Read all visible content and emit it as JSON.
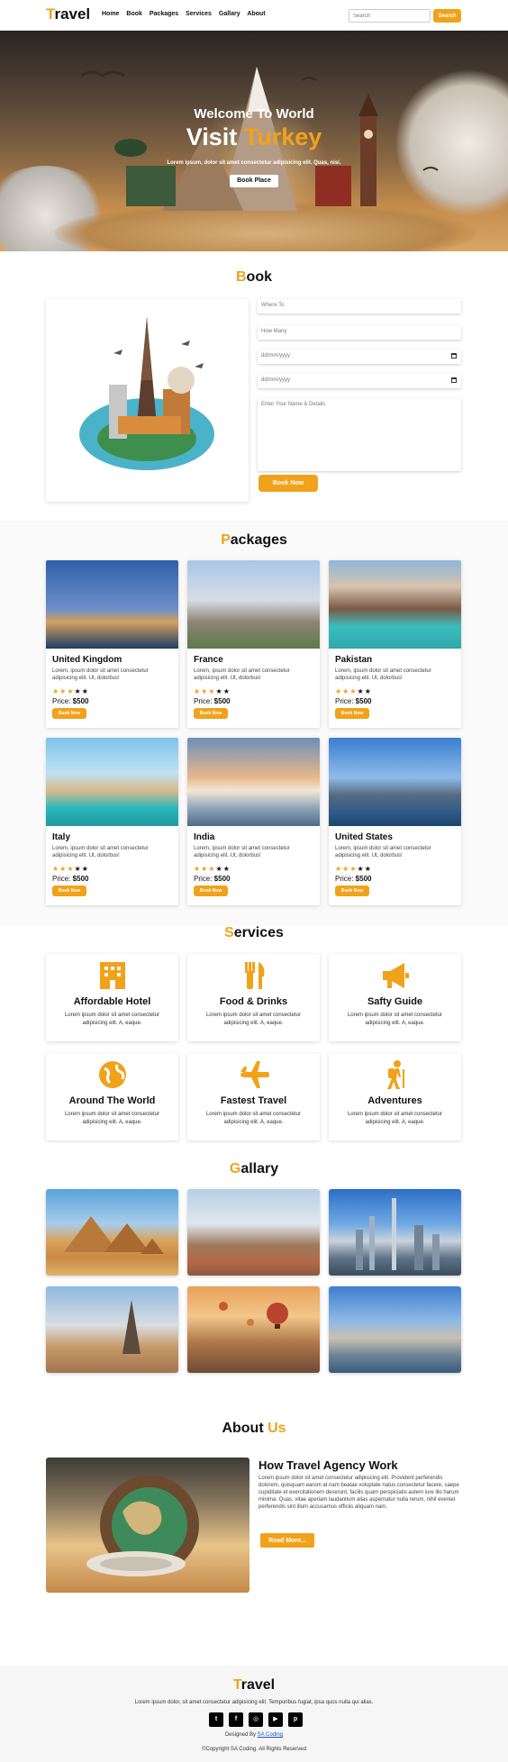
{
  "nav": {
    "logo_first": "T",
    "logo_rest": "ravel",
    "links": [
      "Home",
      "Book",
      "Packages",
      "Services",
      "Gallary",
      "About"
    ],
    "search_placeholder": "Search",
    "search_button": "Search"
  },
  "hero": {
    "subtitle": "Welcome To World",
    "title_white": "Visit ",
    "title_orange": "Turkey",
    "description": "Lorem ipsum, dolor sit amet consectetur adipisicing elit. Quas, nisi.",
    "button": "Book Place"
  },
  "book": {
    "title_first": "B",
    "title_rest": "ook",
    "fields": [
      "Where To",
      "How Many",
      "dd/mm/yyyy",
      "dd/mm/yyyy"
    ],
    "textarea_placeholder": "Enter Your Name & Details",
    "button": "Book Now"
  },
  "packages": {
    "title_first": "P",
    "title_rest": "ackages",
    "description": "Lorem, ipsum dolor sit amet consectetur adipisicing elit. Ut, dolorbus!",
    "price_label": "Price: ",
    "price": "$500",
    "button": "Book Now",
    "items": [
      {
        "name": "United Kingdom",
        "rating": 3
      },
      {
        "name": "France",
        "rating": 3
      },
      {
        "name": "Pakistan",
        "rating": 3
      },
      {
        "name": "Italy",
        "rating": 3
      },
      {
        "name": "India",
        "rating": 3
      },
      {
        "name": "United States",
        "rating": 3
      }
    ]
  },
  "services": {
    "title_first": "S",
    "title_rest": "ervices",
    "description": "Lorem ipsum dolor sit amet consectetur adipisicing elit. A, eaque.",
    "items": [
      {
        "name": "Affordable Hotel",
        "icon": "hotel-icon"
      },
      {
        "name": "Food & Drinks",
        "icon": "utensils-icon"
      },
      {
        "name": "Safty Guide",
        "icon": "megaphone-icon"
      },
      {
        "name": "Around The World",
        "icon": "globe-icon"
      },
      {
        "name": "Fastest Travel",
        "icon": "plane-icon"
      },
      {
        "name": "Adventures",
        "icon": "hiker-icon"
      }
    ]
  },
  "gallery": {
    "title_first": "G",
    "title_rest": "allary"
  },
  "about": {
    "title_first": "About ",
    "title_orange": "Us",
    "heading": "How Travel Agency Work",
    "paragraph": "Lorem ipsum dolor sit amet consectetur adipisicing elit. Provident perferendis dolorem, quisquam earum at nam beatae voluptate natus consectetur facere, saepe cupiditate et exercitationem deserunt, facilis quam perspiciatis autem iure illo harum minima. Quas, vitae aperiam laudantium alias aspernatur nulla rerum, nihil eveniet perferendis sint illum accusamus officiis aliquam nam.",
    "button": "Read More..."
  },
  "footer": {
    "logo_first": "T",
    "logo_rest": "ravel",
    "description": "Lorem ipsum dolor, sit amet consectetur adipisicing elit. Temporibus fugiat, ipsa quos nulla qui alias.",
    "designed_prefix": "Designed By ",
    "designed_link": "SA Coding",
    "copyright": "©Copyright SA Coding. All Rights Reserved",
    "socials": [
      "twitter-icon",
      "facebook-icon",
      "instagram-icon",
      "youtube-icon",
      "pinterest-icon"
    ]
  },
  "colors": {
    "accent": "#f0a21b"
  }
}
